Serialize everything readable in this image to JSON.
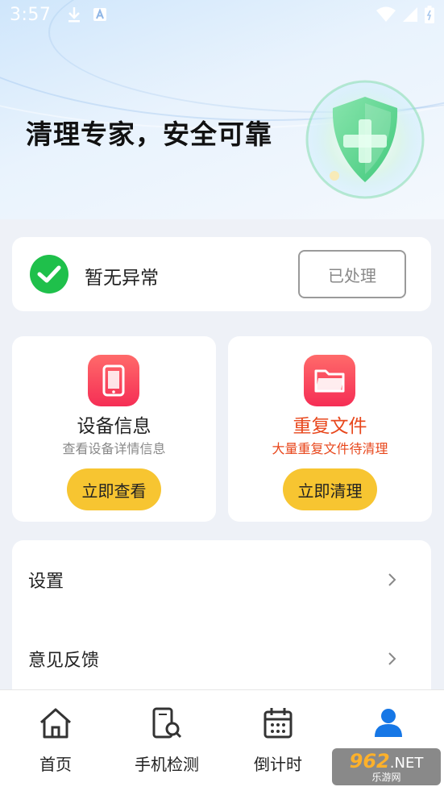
{
  "status_bar": {
    "time": "3:57",
    "icons": [
      "download-icon",
      "text-a-icon",
      "wifi-icon",
      "signal-icon",
      "battery-icon"
    ]
  },
  "hero": {
    "title": "清理专家，安全可靠"
  },
  "status_card": {
    "message": "暂无异常",
    "button_label": "已处理"
  },
  "features": [
    {
      "title": "设备信息",
      "subtitle": "查看设备详情信息",
      "button_label": "立即查看",
      "icon": "phone-icon",
      "title_color": "#222222",
      "subtitle_color": "#888888"
    },
    {
      "title": "重复文件",
      "subtitle": "大量重复文件待清理",
      "button_label": "立即清理",
      "icon": "folder-icon",
      "title_color": "#e8471c",
      "subtitle_color": "#e8471c"
    }
  ],
  "menu": [
    {
      "label": "设置"
    },
    {
      "label": "意见反馈"
    }
  ],
  "tabs": [
    {
      "label": "首页",
      "icon": "home-icon"
    },
    {
      "label": "手机检测",
      "icon": "phone-scan-icon"
    },
    {
      "label": "倒计时",
      "icon": "calendar-icon"
    },
    {
      "label": "",
      "icon": "user-icon",
      "active": true
    }
  ],
  "watermark": {
    "brand": "962",
    "suffix": ".NET",
    "caption": "乐游网"
  },
  "colors": {
    "accent_yellow": "#f7c531",
    "check_green": "#1fc04b",
    "active_tab_blue": "#1677e6",
    "warning_orange": "#e8471c"
  }
}
